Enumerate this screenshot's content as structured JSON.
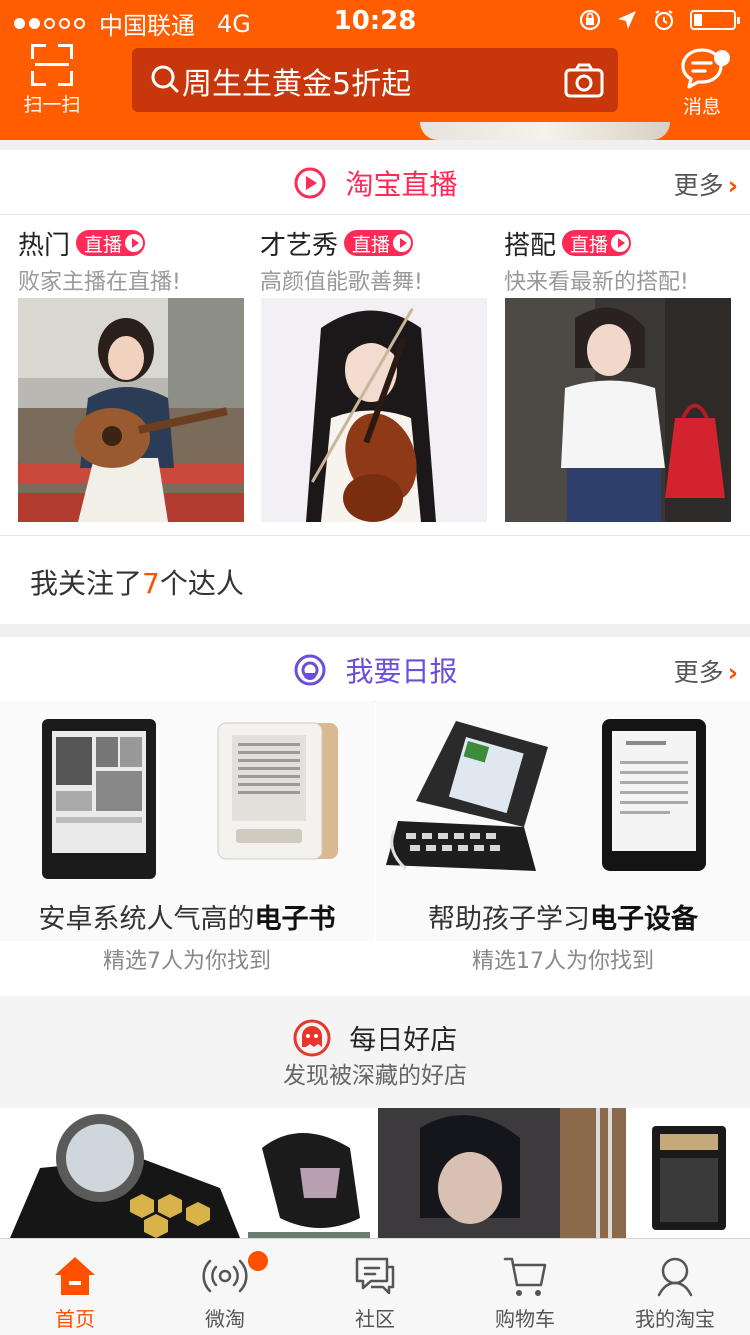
{
  "status_bar": {
    "carrier": "中国联通",
    "network": "4G",
    "time": "10:28",
    "battery_level": 0.2
  },
  "header": {
    "scan_label": "扫一扫",
    "search_text": "周生生黄金5折起",
    "message_label": "消息"
  },
  "live": {
    "title": "淘宝直播",
    "more": "更多",
    "badge": "直播",
    "items": [
      {
        "name": "热门",
        "sub": "败家主播在直播!"
      },
      {
        "name": "才艺秀",
        "sub": "高颜值能歌善舞!"
      },
      {
        "name": "搭配",
        "sub": "快来看最新的搭配!"
      }
    ],
    "follow_prefix": "我关注了",
    "follow_count": "7",
    "follow_suffix": "个达人"
  },
  "daily": {
    "title": "我要日报",
    "more": "更多",
    "items": [
      {
        "title_plain": "安卓系统人气高的",
        "title_bold": "电子书",
        "sub": "精选7人为你找到"
      },
      {
        "title_plain": "帮助孩子学习",
        "title_bold": "电子设备",
        "sub": "精选17人为你找到"
      }
    ]
  },
  "shops": {
    "title": "每日好店",
    "sub": "发现被深藏的好店"
  },
  "tabs": [
    {
      "label": "首页",
      "icon": "home-icon",
      "active": true
    },
    {
      "label": "微淘",
      "icon": "broadcast-icon"
    },
    {
      "label": "社区",
      "icon": "community-icon"
    },
    {
      "label": "购物车",
      "icon": "cart-icon"
    },
    {
      "label": "我的淘宝",
      "icon": "profile-icon"
    }
  ],
  "colors": {
    "brand_orange": "#ff5d00",
    "search_bg": "#c7370b",
    "live_red": "#ff2a55",
    "daily_purple": "#6a4fd8",
    "accent": "#ff5000"
  }
}
